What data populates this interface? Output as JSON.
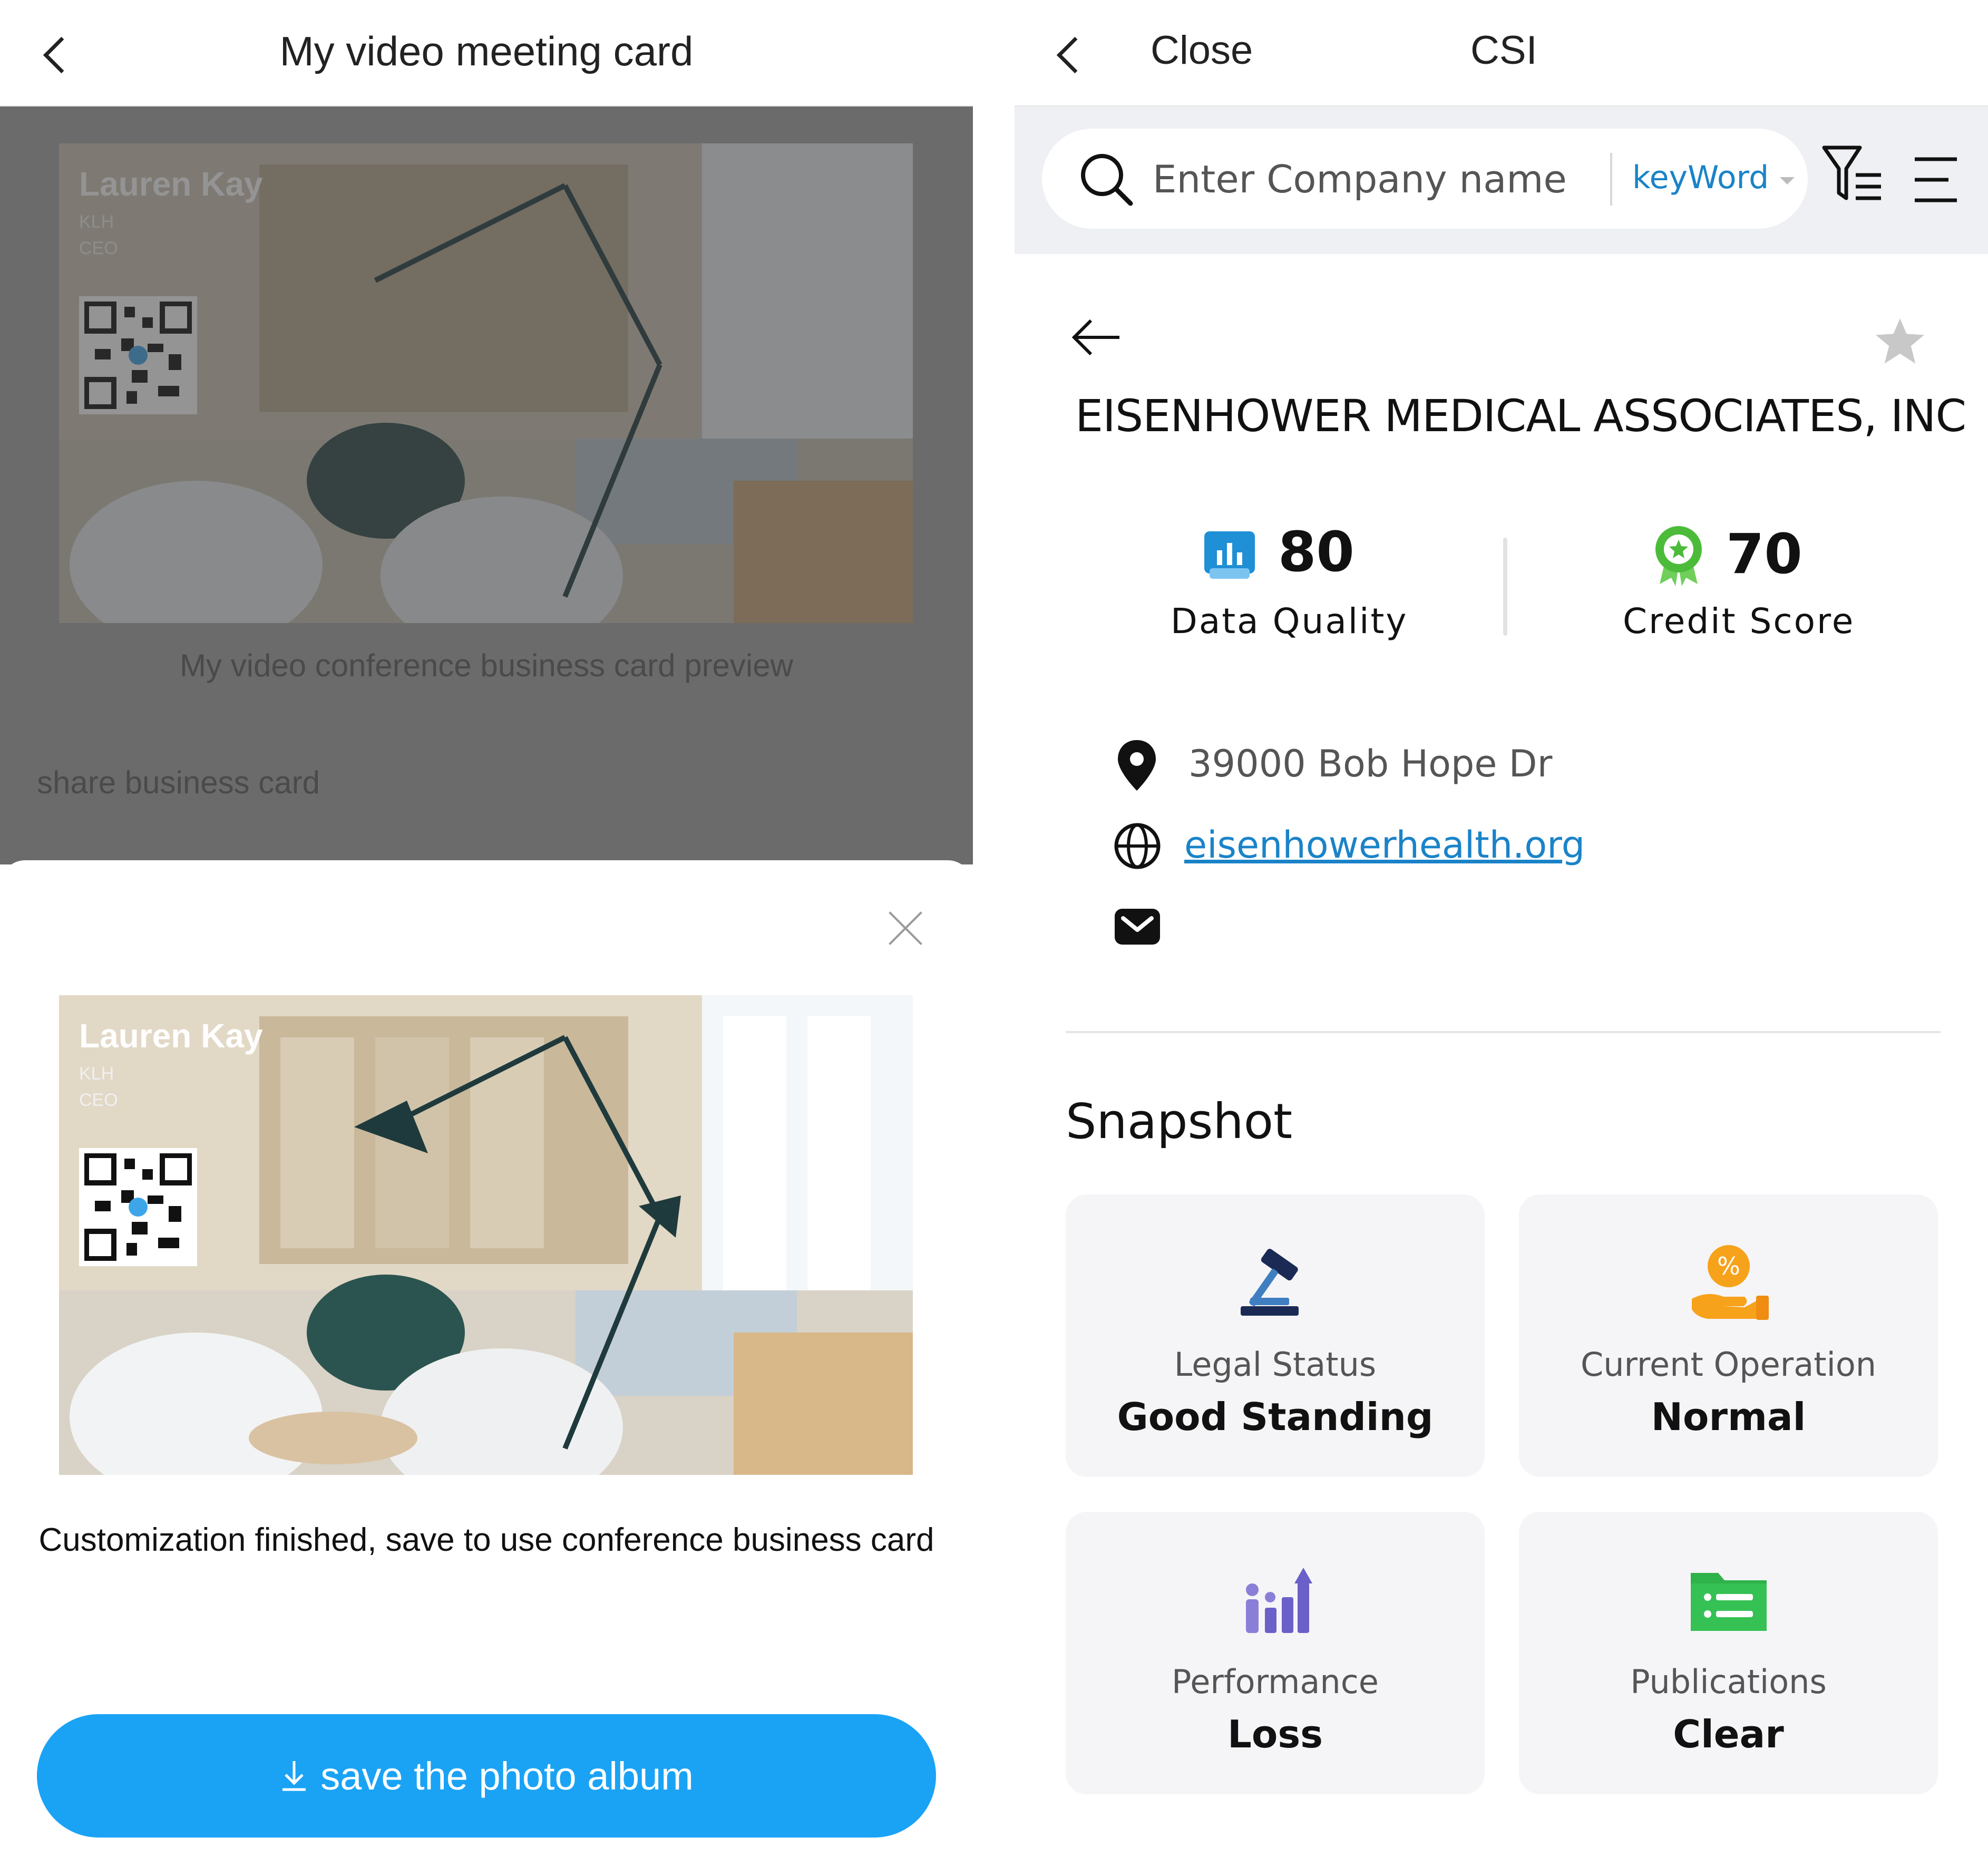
{
  "left_panel": {
    "header": {
      "title": "My video meeting card"
    },
    "card": {
      "name": "Lauren Kay",
      "company": "KLH",
      "role": "CEO"
    },
    "background": {
      "preview_caption": "My video conference business card preview",
      "share_label": "share business card"
    },
    "sheet": {
      "message": "Customization finished, save to use conference business card",
      "save_button": "save the photo album"
    },
    "colors": {
      "accent": "#1aa3f5"
    }
  },
  "right_panel": {
    "header": {
      "close_label": "Close",
      "title": "CSI"
    },
    "search": {
      "placeholder": "Enter Company name",
      "value": "",
      "mode": "keyWord"
    },
    "company": {
      "name": "EISENHOWER MEDICAL ASSOCIATES, INC",
      "data_quality": {
        "value": "80",
        "label": "Data Quality"
      },
      "credit_score": {
        "value": "70",
        "label": "Credit Score"
      },
      "address": "39000 Bob Hope Dr",
      "website": "eisenhowerhealth.org",
      "email": ""
    },
    "snapshot": {
      "title": "Snapshot",
      "tiles": [
        {
          "label": "Legal Status",
          "value": "Good Standing",
          "icon": "gavel-icon"
        },
        {
          "label": "Current Operation",
          "value": "Normal",
          "icon": "percent-hand-icon"
        },
        {
          "label": "Performance",
          "value": "Loss",
          "icon": "growth-chart-icon"
        },
        {
          "label": "Publications",
          "value": "Clear",
          "icon": "folder-list-icon"
        }
      ]
    },
    "colors": {
      "link": "#1a83c8",
      "tile_bg": "#f5f5f7"
    }
  }
}
